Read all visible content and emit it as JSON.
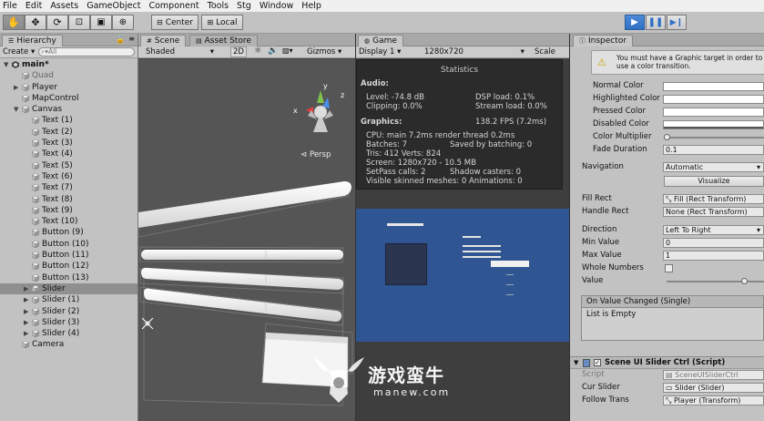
{
  "menu": [
    "File",
    "Edit",
    "Assets",
    "GameObject",
    "Component",
    "Tools",
    "Stg",
    "Window",
    "Help"
  ],
  "toolbar": {
    "pivot": "Center",
    "space": "Local"
  },
  "hierarchy": {
    "tab": "Hierarchy",
    "create": "Create",
    "search_placeholder": "All",
    "items": [
      {
        "label": "main*",
        "indent": 0,
        "arrow": "▼",
        "type": "scene"
      },
      {
        "label": "Quad",
        "indent": 1,
        "arrow": "",
        "type": "go",
        "dim": true
      },
      {
        "label": "Player",
        "indent": 1,
        "arrow": "▶",
        "type": "go"
      },
      {
        "label": "MapControl",
        "indent": 1,
        "arrow": "",
        "type": "go"
      },
      {
        "label": "Canvas",
        "indent": 1,
        "arrow": "▼",
        "type": "go"
      },
      {
        "label": "Text (1)",
        "indent": 2,
        "arrow": "",
        "type": "go"
      },
      {
        "label": "Text (2)",
        "indent": 2,
        "arrow": "",
        "type": "go"
      },
      {
        "label": "Text (3)",
        "indent": 2,
        "arrow": "",
        "type": "go"
      },
      {
        "label": "Text (4)",
        "indent": 2,
        "arrow": "",
        "type": "go"
      },
      {
        "label": "Text (5)",
        "indent": 2,
        "arrow": "",
        "type": "go"
      },
      {
        "label": "Text (6)",
        "indent": 2,
        "arrow": "",
        "type": "go"
      },
      {
        "label": "Text (7)",
        "indent": 2,
        "arrow": "",
        "type": "go"
      },
      {
        "label": "Text (8)",
        "indent": 2,
        "arrow": "",
        "type": "go"
      },
      {
        "label": "Text (9)",
        "indent": 2,
        "arrow": "",
        "type": "go"
      },
      {
        "label": "Text (10)",
        "indent": 2,
        "arrow": "",
        "type": "go"
      },
      {
        "label": "Button (9)",
        "indent": 2,
        "arrow": "",
        "type": "go"
      },
      {
        "label": "Button (10)",
        "indent": 2,
        "arrow": "",
        "type": "go"
      },
      {
        "label": "Button (11)",
        "indent": 2,
        "arrow": "",
        "type": "go"
      },
      {
        "label": "Button (12)",
        "indent": 2,
        "arrow": "",
        "type": "go"
      },
      {
        "label": "Button (13)",
        "indent": 2,
        "arrow": "",
        "type": "go"
      },
      {
        "label": "Slider",
        "indent": 2,
        "arrow": "▶",
        "type": "go",
        "selected": true
      },
      {
        "label": "Slider (1)",
        "indent": 2,
        "arrow": "▶",
        "type": "go"
      },
      {
        "label": "Slider (2)",
        "indent": 2,
        "arrow": "▶",
        "type": "go"
      },
      {
        "label": "Slider (3)",
        "indent": 2,
        "arrow": "▶",
        "type": "go"
      },
      {
        "label": "Slider (4)",
        "indent": 2,
        "arrow": "▶",
        "type": "go"
      },
      {
        "label": "Camera",
        "indent": 1,
        "arrow": "",
        "type": "go"
      }
    ]
  },
  "scene": {
    "tab": "Scene",
    "tab2": "Asset Store",
    "shading": "Shaded",
    "mode": "2D",
    "gizmos": "Gizmos",
    "persp": "Persp",
    "gizmo_axes": {
      "y": "y",
      "z": "z",
      "x": "x"
    }
  },
  "game": {
    "tab": "Game",
    "display": "Display 1",
    "resolution": "1280x720",
    "scale": "Scale",
    "stats": {
      "title": "Statistics",
      "audio_header": "Audio:",
      "level": "Level: -74.8 dB",
      "dsp": "DSP load: 0.1%",
      "clipping": "Clipping: 0.0%",
      "stream": "Stream load: 0.0%",
      "graphics_header": "Graphics:",
      "fps": "138.2 FPS (7.2ms)",
      "cpu": "CPU: main 7.2ms  render thread 0.2ms",
      "batches": "Batches: 7",
      "saved": "Saved by batching: 0",
      "tris": "Tris: 412  Verts: 824",
      "screen": "Screen: 1280x720 - 10.5 MB",
      "setpass": "SetPass calls: 2",
      "shadow": "Shadow casters: 0",
      "skinned": "Visible skinned meshes: 0  Animations: 0"
    }
  },
  "inspector": {
    "tab": "Inspector",
    "warning": "You must have a Graphic target in order to use a color transition.",
    "colors": [
      {
        "k": "Normal Color"
      },
      {
        "k": "Highlighted Color"
      },
      {
        "k": "Pressed Color"
      },
      {
        "k": "Disabled Color"
      }
    ],
    "color_multiplier_label": "Color Multiplier",
    "fade_label": "Fade Duration",
    "fade_value": "0.1",
    "navigation_label": "Navigation",
    "navigation_value": "Automatic",
    "visualize": "Visualize",
    "fill_rect_label": "Fill Rect",
    "fill_rect_value": "Fill (Rect Transform)",
    "handle_rect_label": "Handle Rect",
    "handle_rect_value": "None (Rect Transform)",
    "direction_label": "Direction",
    "direction_value": "Left To Right",
    "min_label": "Min Value",
    "min_value": "0",
    "max_label": "Max Value",
    "max_value": "1",
    "whole_label": "Whole Numbers",
    "value_label": "Value",
    "event_header": "On Value Changed (Single)",
    "event_empty": "List is Empty",
    "component_title": "Scene UI Slider Ctrl (Script)",
    "script_label": "Script",
    "script_value": "SceneUISliderCtrl",
    "cur_slider_label": "Cur Slider",
    "cur_slider_value": "Slider (Slider)",
    "follow_label": "Follow Trans",
    "follow_value": "Player (Transform)"
  },
  "watermark": {
    "cn": "游戏蛮牛",
    "en": "manew.com"
  }
}
